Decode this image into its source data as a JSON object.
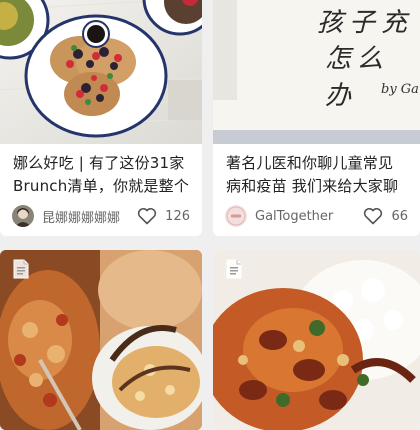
{
  "feed": {
    "cards": [
      {
        "title_line1": "娜么好吃 | 有了这份31家",
        "title_line2": "Brunch清单，你就是整个",
        "author": "昆娜娜娜娜娜",
        "likes": "126",
        "like_icon": "heart-outline-icon",
        "avatar_icon": "user-avatar"
      },
      {
        "image_text_line1": "孩子充",
        "image_text_line2": "怎么办",
        "image_text_sign": "by Ga",
        "title_line1": "著名儿医和你聊儿童常见",
        "title_line2": "病和疫苗 我们来给大家聊",
        "author": "GalTogether",
        "likes": "66",
        "like_icon": "heart-outline-icon",
        "avatar_icon": "brand-avatar"
      },
      {
        "badge_icon": "document-icon"
      },
      {
        "badge_icon": "document-icon"
      }
    ]
  },
  "colors": {
    "background": "#efefef",
    "card": "#ffffff",
    "text": "#222222",
    "muted": "#666666"
  }
}
